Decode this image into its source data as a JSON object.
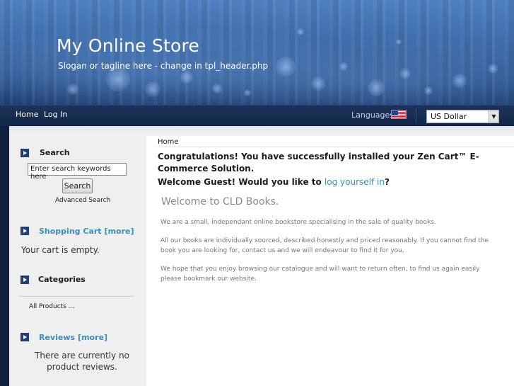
{
  "header": {
    "site_title": "My Online Store",
    "tagline": "Slogan or tagline here - change in tpl_header.php"
  },
  "nav": {
    "home": "Home",
    "login": "Log In",
    "languages_label": "Languages",
    "flag_icon": "us-flag-icon",
    "currency_selected": "US Dollar"
  },
  "sidebar": {
    "search": {
      "heading": "Search",
      "placeholder": "Enter search keywords here",
      "button": "Search",
      "advanced": "Advanced Search"
    },
    "cart": {
      "heading": "Shopping Cart",
      "more": "[more]",
      "empty": "Your cart is empty."
    },
    "categories": {
      "heading": "Categories",
      "items": [
        "All Products ..."
      ]
    },
    "reviews": {
      "heading": "Reviews",
      "more": "[more]",
      "empty": "There are currently no product reviews."
    }
  },
  "main": {
    "breadcrumb": "Home",
    "congrats": "Congratulations! You have successfully installed your Zen Cart™ E-Commerce Solution.",
    "welcome_prefix": "Welcome Guest! Would you like to ",
    "welcome_link": "log yourself in",
    "welcome_suffix": "?",
    "welcome_heading": "Welcome to CLD Books.",
    "paragraphs": [
      "We are a small, independant online bookstore specialising in the sale of quality books.",
      "All our books are individually sourced, described honestly and priced reasonably. If you cannot find the book you are looking for, contact us and we will endeavour to find it for you.",
      "We hope that you enjoy browsing our catalogue and will want to return often, to find us again easily please bookmark our website."
    ]
  },
  "colors": {
    "nav_bg": "#13264a",
    "link": "#3a8fb8",
    "sidebar_bg": "#efefef",
    "box_icon": "#1e3e75"
  }
}
